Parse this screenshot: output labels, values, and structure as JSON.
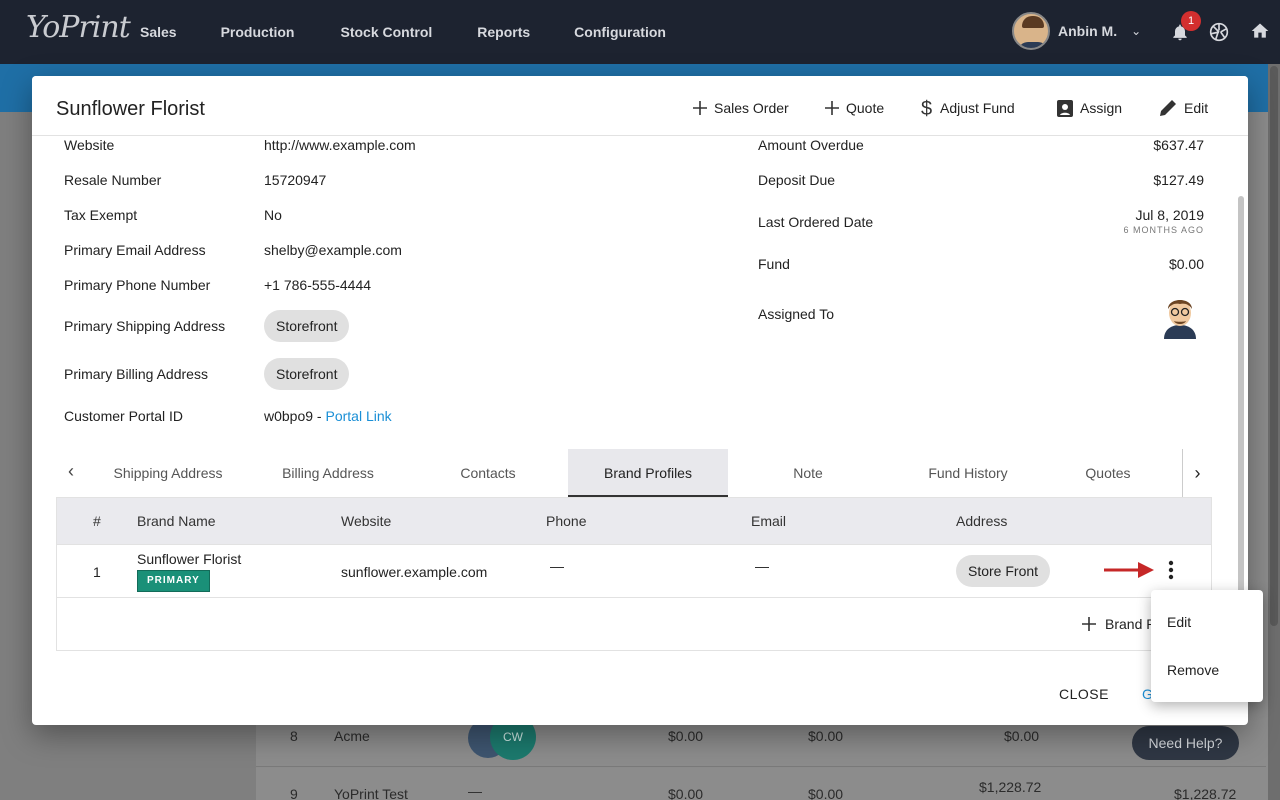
{
  "nav": {
    "logo": "YoPrint",
    "links": [
      "Sales",
      "Production",
      "Stock Control",
      "Reports",
      "Configuration"
    ],
    "user_name": "Anbin M.",
    "notification_count": "1"
  },
  "modal": {
    "title": "Sunflower Florist",
    "actions": {
      "sales_order": "Sales Order",
      "quote": "Quote",
      "adjust_fund": "Adjust Fund",
      "assign": "Assign",
      "edit": "Edit"
    },
    "left_fields": [
      {
        "label": "Website",
        "value": "http://www.example.com"
      },
      {
        "label": "Resale Number",
        "value": "15720947"
      },
      {
        "label": "Tax Exempt",
        "value": "No"
      },
      {
        "label": "Primary Email Address",
        "value": "shelby@example.com"
      },
      {
        "label": "Primary Phone Number",
        "value": "+1 786-555-4444"
      },
      {
        "label": "Primary Shipping Address",
        "value": "Storefront"
      },
      {
        "label": "Primary Billing Address",
        "value": "Storefront"
      },
      {
        "label": "Customer Portal ID",
        "value": "w0bpo9 - ",
        "link": "Portal Link"
      }
    ],
    "right_fields": [
      {
        "label": "Amount Overdue",
        "value": "$637.47"
      },
      {
        "label": "Deposit Due",
        "value": "$127.49"
      },
      {
        "label": "Last Ordered Date",
        "value": "Jul 8, 2019",
        "sub": "6 MONTHS AGO"
      },
      {
        "label": "Fund",
        "value": "$0.00"
      },
      {
        "label": "Assigned To",
        "value": ""
      }
    ],
    "tabs": [
      "Shipping Address",
      "Billing Address",
      "Contacts",
      "Brand Profiles",
      "Note",
      "Fund History",
      "Quotes"
    ],
    "active_tab": "Brand Profiles",
    "table": {
      "headers": [
        "#",
        "Brand Name",
        "Website",
        "Phone",
        "Email",
        "Address"
      ],
      "rows": [
        {
          "num": "1",
          "brand": "Sunflower Florist",
          "badge": "PRIMARY",
          "website": "sunflower.example.com",
          "phone": "—",
          "email": "—",
          "address": "Store Front"
        }
      ],
      "add_label": "Brand P"
    },
    "footer": {
      "close": "CLOSE",
      "other": "G"
    },
    "menu": [
      "Edit",
      "Remove"
    ]
  },
  "background": {
    "rows": [
      {
        "num": "8",
        "name": "Acme",
        "c1": "$0.00",
        "c2": "$0.00",
        "c3": "$0.00",
        "c4": ""
      },
      {
        "num": "9",
        "name": "YoPrint Test",
        "c0": "—",
        "c1": "$0.00",
        "c2": "$0.00",
        "c3": "$1,228.72",
        "c4": "$1,228.72"
      }
    ],
    "avatar_initials": "CW",
    "need_help": "Need Help?"
  },
  "colors": {
    "nav_bg": "#1d2330",
    "accent_blue": "#1a8fd6",
    "primary_badge": "#1a9078",
    "arrow_red": "#c62828"
  }
}
